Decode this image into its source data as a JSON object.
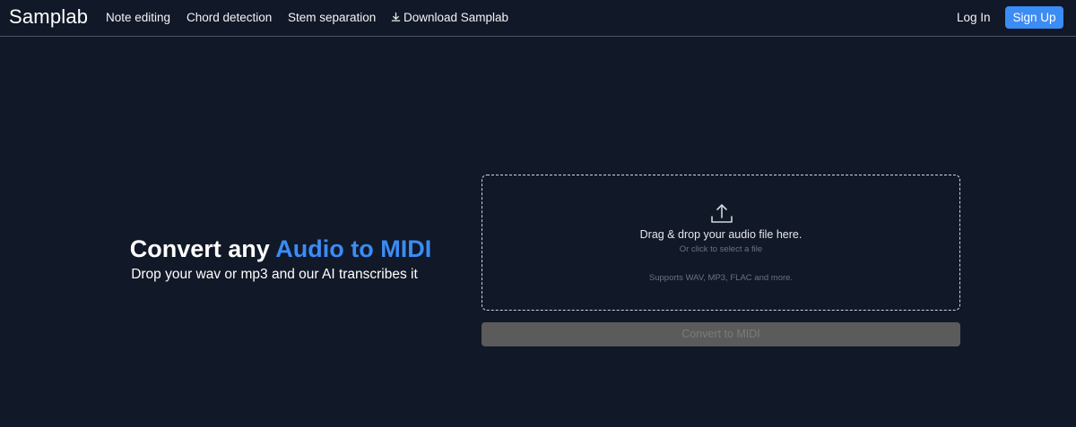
{
  "nav": {
    "logo": "Samplab",
    "links": [
      "Note editing",
      "Chord detection",
      "Stem separation"
    ],
    "download_label": "Download Samplab",
    "login_label": "Log In",
    "signup_label": "Sign Up"
  },
  "hero": {
    "title_prefix": "Convert any ",
    "title_accent": "Audio to MIDI",
    "subtitle": "Drop your wav or mp3 and our AI transcribes it"
  },
  "dropzone": {
    "icon": "upload-icon",
    "main_text": "Drag & drop your audio file here.",
    "alt_text": "Or click to select a file",
    "supports_text": "Supports WAV, MP3, FLAC and more."
  },
  "convert_button": {
    "label": "Convert to MIDI",
    "disabled": true
  },
  "colors": {
    "background": "#111827",
    "accent": "#3b8cf5",
    "button_disabled": "#5b5b5b"
  }
}
